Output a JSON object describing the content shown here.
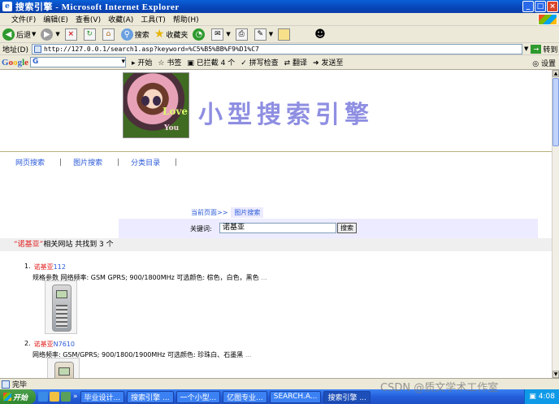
{
  "window": {
    "title": "搜索引擎 - Microsoft Internet Explorer",
    "buttons": {
      "minimize": "_",
      "maximize": "□",
      "close": "×"
    }
  },
  "menu": [
    "文件(F)",
    "编辑(E)",
    "查看(V)",
    "收藏(A)",
    "工具(T)",
    "帮助(H)"
  ],
  "toolbar": {
    "back": "后退",
    "search": "搜索",
    "favorites": "收藏夹"
  },
  "address": {
    "label": "地址(D)",
    "url": "http://127.0.0.1/search1.asp?keyword=%C5%B5%BB%F9%D1%C7",
    "go": "转到"
  },
  "googlebar": {
    "logo": [
      "G",
      "o",
      "o",
      "g",
      "l",
      "e"
    ],
    "search_value": "G",
    "items": [
      "开始",
      "书签",
      "已拦截 4 个",
      "拼写检查",
      "翻译",
      "发送至"
    ],
    "settings": "设置"
  },
  "page": {
    "banner_title": "小型搜索引擎",
    "banner_love": "Love",
    "banner_you": "You",
    "nav": [
      "网页搜索",
      "图片搜索",
      "分类目录"
    ],
    "nav_sep": "|",
    "crumb_current": "当前页面>>",
    "crumb_tab": "图片搜索",
    "keyword_label": "关键词:",
    "keyword_value": "诺基亚",
    "search_button": "搜索",
    "summary": {
      "query": "“诺基亚”",
      "text": "相关网站 共找到 3 个"
    },
    "results": [
      {
        "index": "1.",
        "highlight": "诺基亚",
        "model": "112",
        "spec": "规格参数   网络频率: GSM GPRS; 900/1800MHz    可选颜色: 棕色，白色，黑色",
        "dots": "..."
      },
      {
        "index": "2.",
        "highlight": "诺基亚",
        "model": "N7610",
        "spec": "网络频率: GSM/GPRS; 900/1800/1900MHz  可选颜色: 珍珠白、石墨黑",
        "dots": "..."
      }
    ]
  },
  "status": {
    "text": "完毕"
  },
  "taskbar": {
    "start": "开始",
    "tasks": [
      "毕业设计...",
      "搜索引擎 ...",
      "一个小型...",
      "亿图专业...",
      "SEARCH.A...",
      "搜索引擎 ..."
    ],
    "time": "4:08"
  },
  "watermark": "CSDN @质文学术工作室"
}
